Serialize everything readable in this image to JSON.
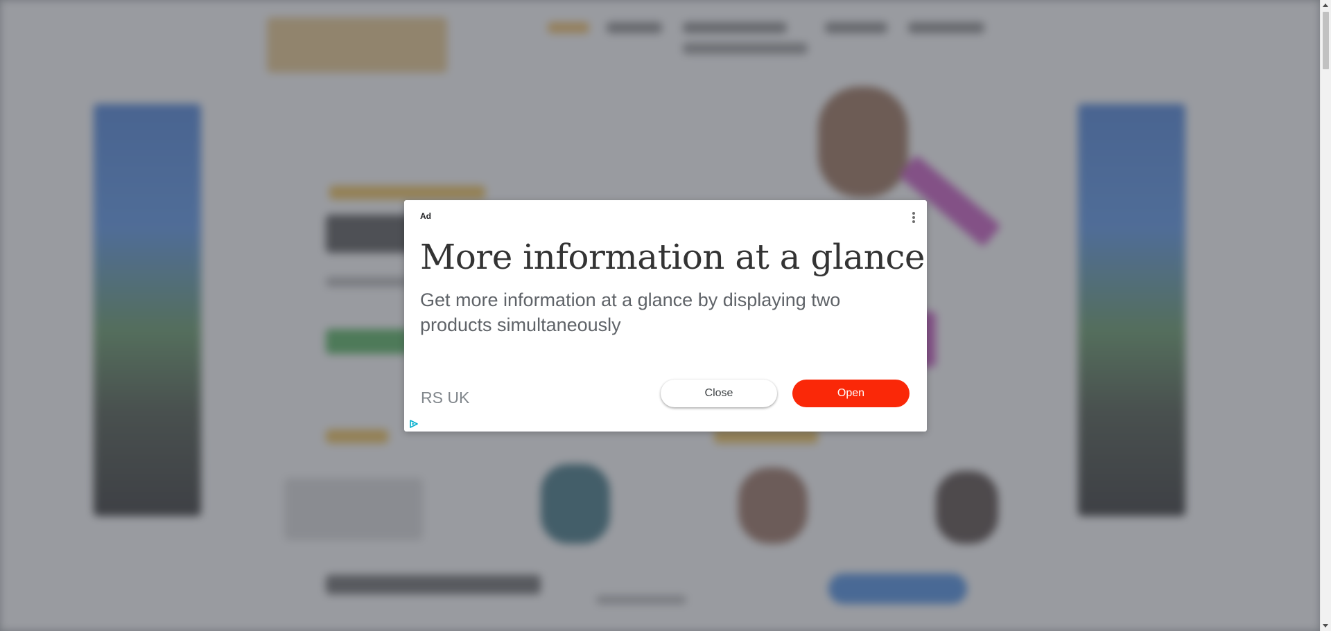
{
  "ad": {
    "label": "Ad",
    "headline": "More information at a glance",
    "description": "Get more information at a glance by displaying two products simultaneously",
    "advertiser": "RS UK",
    "close_label": "Close",
    "open_label": "Open",
    "menu_icon": "kebab-menu-icon",
    "adchoices_icon": "adchoices-icon"
  },
  "colors": {
    "open_button": "#fa2808",
    "overlay": "#5a5e66",
    "adchoices": "#00aecd"
  }
}
